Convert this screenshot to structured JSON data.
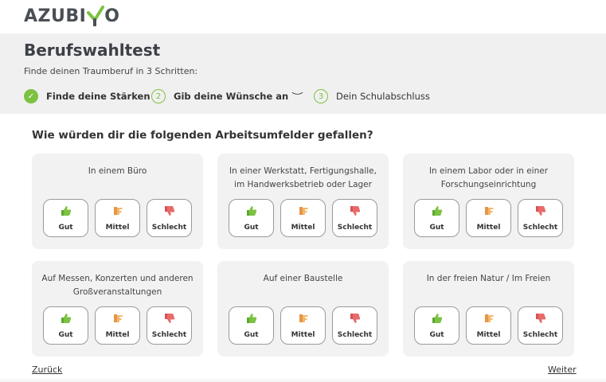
{
  "brand": {
    "logo_text": "AZUBI",
    "logo_tail": "O"
  },
  "header": {
    "title": "Berufswahltest",
    "subtitle": "Finde deinen Traumberuf in 3 Schritten:"
  },
  "steps": [
    {
      "number": "✓",
      "label": "Finde deine Stärken",
      "state": "done"
    },
    {
      "number": "2",
      "label": "Gib deine Wünsche an",
      "state": "active"
    },
    {
      "number": "3",
      "label": "Dein Schulabschluss",
      "state": "todo"
    }
  ],
  "question": "Wie würden dir die folgenden Arbeitsumfelder gefallen?",
  "button_labels": {
    "good": "Gut",
    "medium": "Mittel",
    "bad": "Schlecht"
  },
  "cards": [
    {
      "text": "In einem Büro"
    },
    {
      "text": "In einer Werkstatt, Fertigungshalle, im Handwerksbetrieb oder Lager"
    },
    {
      "text": "In einem Labor oder in einer Forschungseinrichtung"
    },
    {
      "text": "Auf Messen, Konzerten und anderen Großveranstaltungen"
    },
    {
      "text": "Auf einer Baustelle"
    },
    {
      "text": "In der freien Natur / Im Freien"
    }
  ],
  "nav": {
    "back": "Zurück",
    "next": "Weiter"
  },
  "colors": {
    "accent": "#7cc242",
    "good": "#6cbf3a",
    "medium": "#f0a85a",
    "bad": "#e86a6a"
  }
}
